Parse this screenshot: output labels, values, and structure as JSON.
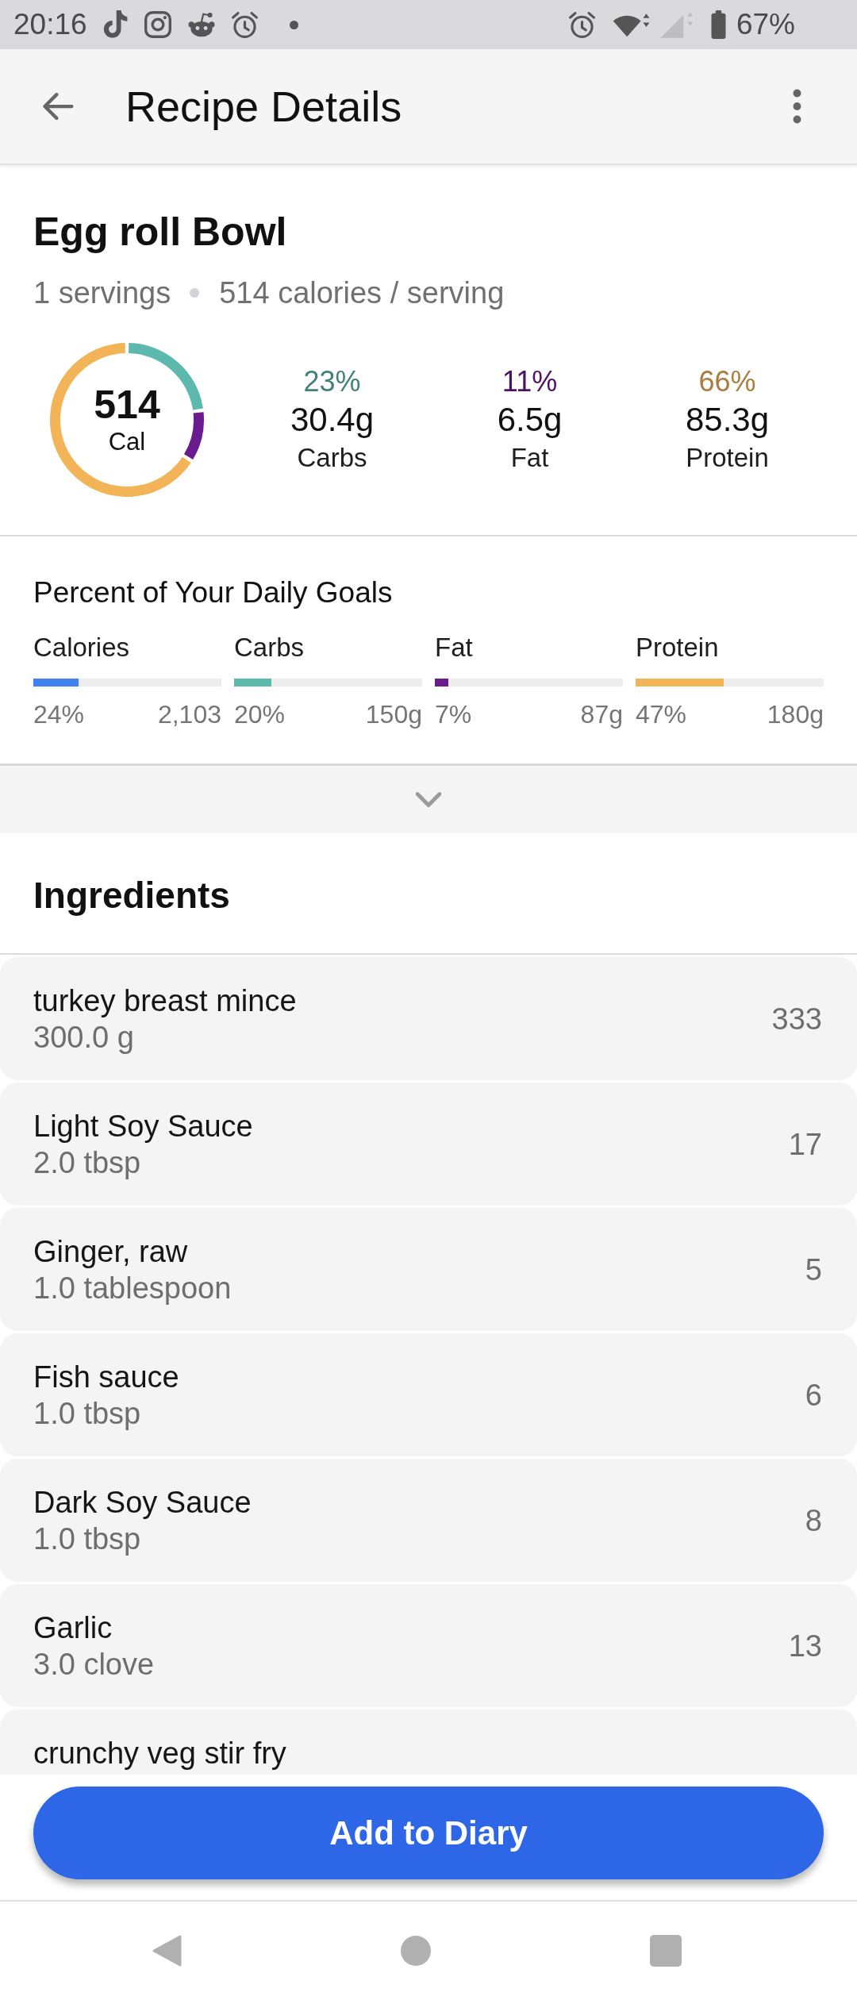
{
  "status_bar": {
    "time": "20:16",
    "battery": "67%"
  },
  "app_bar": {
    "title": "Recipe Details"
  },
  "recipe": {
    "name": "Egg roll Bowl",
    "servings": "1 servings",
    "calories_per_serving": "514 calories / serving",
    "summary": {
      "calories": "514",
      "unit": "Cal",
      "chart_data": {
        "type": "donut",
        "categories": [
          "Carbs",
          "Fat",
          "Protein"
        ],
        "values": [
          23,
          11,
          66
        ]
      },
      "macros": [
        {
          "percent": "23%",
          "amount": "30.4g",
          "color": "#5db8ae"
        },
        {
          "percent": "11%",
          "amount": "6.5g",
          "color": "#6a1b8f"
        },
        {
          "percent": "66%",
          "amount": "85.3g",
          "color": "#f3b458"
        }
      ]
    }
  },
  "daily_goals": {
    "title": "Percent of Your Daily Goals",
    "items": [
      {
        "label": "Calories",
        "level": 0.24,
        "percent": "24%",
        "target": "2,103",
        "color": "#4281f0"
      },
      {
        "label": "Carbs",
        "level": 0.2,
        "percent": "20%",
        "target": "150g",
        "color": "#5db8ae"
      },
      {
        "label": "Fat",
        "level": 0.07,
        "percent": "7%",
        "target": "87g",
        "color": "#6a1b8f"
      },
      {
        "label": "Protein",
        "level": 0.47,
        "percent": "47%",
        "target": "180g",
        "color": "#f3b458"
      }
    ]
  },
  "ingredients": {
    "title": "Ingredients",
    "items": [
      {
        "name": "turkey breast mince",
        "quantity": "300.0 g",
        "calories": "333"
      },
      {
        "name": "Light Soy Sauce",
        "quantity": "2.0 tbsp",
        "calories": "17"
      },
      {
        "name": "Ginger, raw",
        "quantity": "1.0 tablespoon",
        "calories": "5"
      },
      {
        "name": "Fish sauce",
        "quantity": "1.0 tbsp",
        "calories": "6"
      },
      {
        "name": "Dark Soy Sauce",
        "quantity": "1.0 tbsp",
        "calories": "8"
      },
      {
        "name": "Garlic",
        "quantity": "3.0 clove",
        "calories": "13"
      },
      {
        "name": "crunchy veg stir fry"
      }
    ]
  },
  "action_button": {
    "label": "Add to Diary"
  }
}
